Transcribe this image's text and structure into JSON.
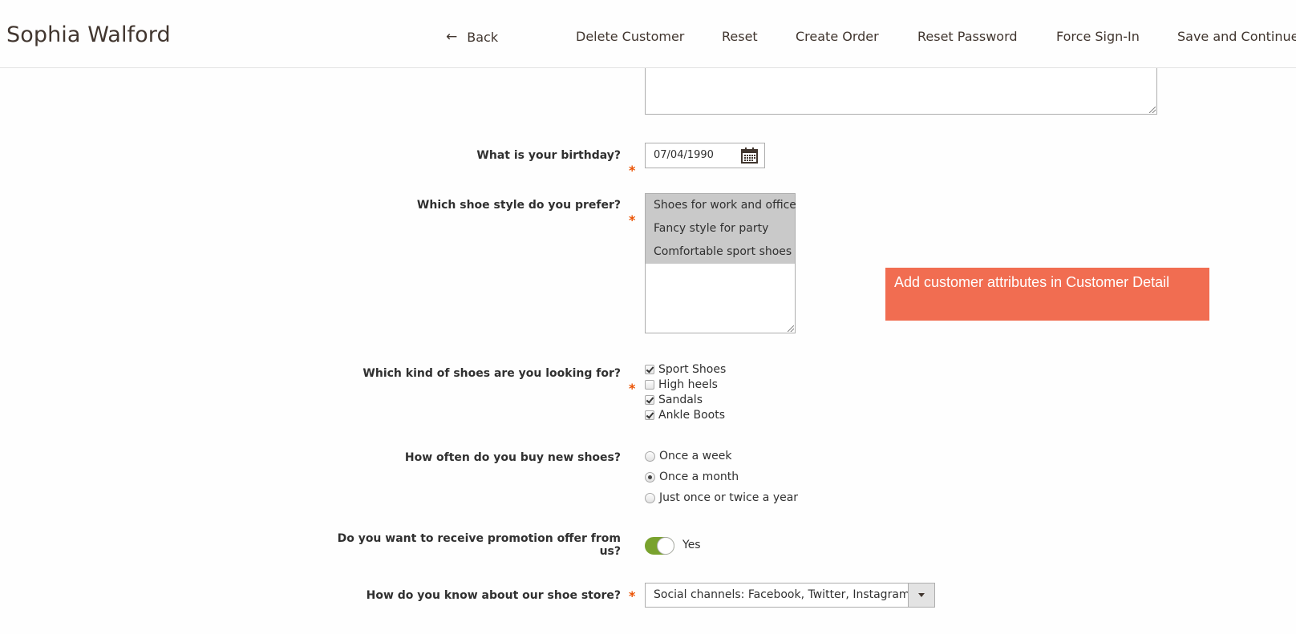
{
  "header": {
    "title": "Sophia Walford",
    "actions": {
      "back": "Back",
      "delete": "Delete Customer",
      "reset": "Reset",
      "create_order": "Create Order",
      "reset_password": "Reset Password",
      "force_signin": "Force Sign-In",
      "save_continue": "Save and Continue Edit"
    }
  },
  "form": {
    "birthday": {
      "label": "What is your birthday?",
      "value": "07/04/1990",
      "required": true
    },
    "shoe_style": {
      "label": "Which shoe style do you prefer?",
      "required": true,
      "options": [
        "Shoes for work and office",
        "Fancy style for party",
        "Comfortable sport shoes"
      ],
      "selected": [
        "Shoes for work and office",
        "Fancy style for party",
        "Comfortable sport shoes"
      ]
    },
    "shoe_kind": {
      "label": "Which kind of shoes are you looking for?",
      "required": true,
      "options": [
        {
          "label": "Sport Shoes",
          "checked": true
        },
        {
          "label": "High heels",
          "checked": false
        },
        {
          "label": "Sandals",
          "checked": true
        },
        {
          "label": "Ankle Boots",
          "checked": true
        }
      ]
    },
    "frequency": {
      "label": "How often do you buy new shoes?",
      "options": [
        {
          "label": "Once a week",
          "checked": false
        },
        {
          "label": "Once a month",
          "checked": true
        },
        {
          "label": "Just once or twice a year",
          "checked": false
        }
      ]
    },
    "promotion": {
      "label_line1": "Do you want to receive promotion offer from",
      "label_line2": "us?",
      "value": "Yes",
      "enabled": true
    },
    "source": {
      "label": "How do you know about our shoe store?",
      "required": true,
      "value": "Social channels: Facebook, Twitter, Instagram..."
    }
  },
  "note": {
    "text": "Add customer attributes in Customer Detail",
    "color": "#f16d51"
  },
  "colors": {
    "required": "#eb5202",
    "toggle_on": "#79a22e"
  }
}
